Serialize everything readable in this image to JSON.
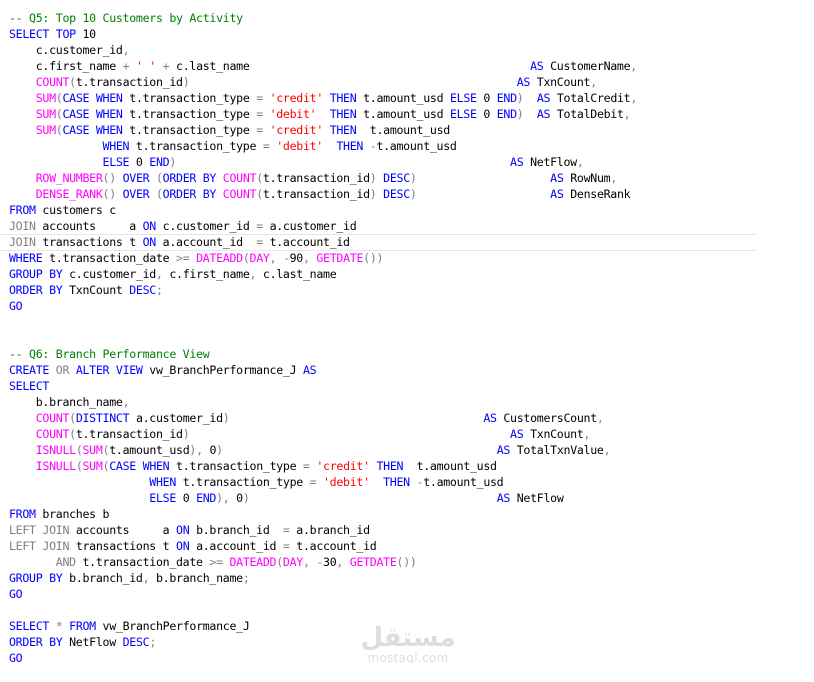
{
  "editor": {
    "lines": [
      [
        {
          "t": "-- Q5: Top 10 Customers by Activity",
          "c": "cm"
        }
      ],
      [
        {
          "t": "SELECT TOP ",
          "c": "kw"
        },
        {
          "t": "10",
          "c": "tx"
        }
      ],
      [
        {
          "t": "    c.customer_id",
          "c": "tx"
        },
        {
          "t": ",",
          "c": "gr"
        }
      ],
      [
        {
          "t": "    c.first_name ",
          "c": "tx"
        },
        {
          "t": "+ ",
          "c": "gr"
        },
        {
          "t": "' '",
          "c": "str"
        },
        {
          "t": " + ",
          "c": "gr"
        },
        {
          "t": "c.last_name                                          ",
          "c": "tx"
        },
        {
          "t": "AS ",
          "c": "kw"
        },
        {
          "t": "CustomerName",
          "c": "tx"
        },
        {
          "t": ",",
          "c": "gr"
        }
      ],
      [
        {
          "t": "    COUNT",
          "c": "fn"
        },
        {
          "t": "(",
          "c": "gr"
        },
        {
          "t": "t.transaction_id",
          "c": "tx"
        },
        {
          "t": ")                                                 ",
          "c": "gr"
        },
        {
          "t": "AS ",
          "c": "kw"
        },
        {
          "t": "TxnCount",
          "c": "tx"
        },
        {
          "t": ",",
          "c": "gr"
        }
      ],
      [
        {
          "t": "    SUM",
          "c": "fn"
        },
        {
          "t": "(",
          "c": "gr"
        },
        {
          "t": "CASE WHEN ",
          "c": "kw"
        },
        {
          "t": "t.transaction_type ",
          "c": "tx"
        },
        {
          "t": "= ",
          "c": "gr"
        },
        {
          "t": "'credit'",
          "c": "str"
        },
        {
          "t": " THEN ",
          "c": "kw"
        },
        {
          "t": "t.amount_usd ",
          "c": "tx"
        },
        {
          "t": "ELSE ",
          "c": "kw"
        },
        {
          "t": "0 ",
          "c": "tx"
        },
        {
          "t": "END",
          "c": "kw"
        },
        {
          "t": ")  ",
          "c": "gr"
        },
        {
          "t": "AS ",
          "c": "kw"
        },
        {
          "t": "TotalCredit",
          "c": "tx"
        },
        {
          "t": ",",
          "c": "gr"
        }
      ],
      [
        {
          "t": "    SUM",
          "c": "fn"
        },
        {
          "t": "(",
          "c": "gr"
        },
        {
          "t": "CASE WHEN ",
          "c": "kw"
        },
        {
          "t": "t.transaction_type ",
          "c": "tx"
        },
        {
          "t": "= ",
          "c": "gr"
        },
        {
          "t": "'debit'",
          "c": "str"
        },
        {
          "t": "  THEN ",
          "c": "kw"
        },
        {
          "t": "t.amount_usd ",
          "c": "tx"
        },
        {
          "t": "ELSE ",
          "c": "kw"
        },
        {
          "t": "0 ",
          "c": "tx"
        },
        {
          "t": "END",
          "c": "kw"
        },
        {
          "t": ")  ",
          "c": "gr"
        },
        {
          "t": "AS ",
          "c": "kw"
        },
        {
          "t": "TotalDebit",
          "c": "tx"
        },
        {
          "t": ",",
          "c": "gr"
        }
      ],
      [
        {
          "t": "    SUM",
          "c": "fn"
        },
        {
          "t": "(",
          "c": "gr"
        },
        {
          "t": "CASE WHEN ",
          "c": "kw"
        },
        {
          "t": "t.transaction_type ",
          "c": "tx"
        },
        {
          "t": "= ",
          "c": "gr"
        },
        {
          "t": "'credit'",
          "c": "str"
        },
        {
          "t": " THEN  ",
          "c": "kw"
        },
        {
          "t": "t.amount_usd",
          "c": "tx"
        }
      ],
      [
        {
          "t": "              WHEN ",
          "c": "kw"
        },
        {
          "t": "t.transaction_type ",
          "c": "tx"
        },
        {
          "t": "= ",
          "c": "gr"
        },
        {
          "t": "'debit'",
          "c": "str"
        },
        {
          "t": "  THEN ",
          "c": "kw"
        },
        {
          "t": "-",
          "c": "gr"
        },
        {
          "t": "t.amount_usd",
          "c": "tx"
        }
      ],
      [
        {
          "t": "              ELSE ",
          "c": "kw"
        },
        {
          "t": "0 ",
          "c": "tx"
        },
        {
          "t": "END",
          "c": "kw"
        },
        {
          "t": ")                                                  ",
          "c": "gr"
        },
        {
          "t": "AS ",
          "c": "kw"
        },
        {
          "t": "NetFlow",
          "c": "tx"
        },
        {
          "t": ",",
          "c": "gr"
        }
      ],
      [
        {
          "t": "    ROW_NUMBER",
          "c": "fn"
        },
        {
          "t": "() ",
          "c": "gr"
        },
        {
          "t": "OVER ",
          "c": "kw"
        },
        {
          "t": "(",
          "c": "gr"
        },
        {
          "t": "ORDER BY ",
          "c": "kw"
        },
        {
          "t": "COUNT",
          "c": "fn"
        },
        {
          "t": "(",
          "c": "gr"
        },
        {
          "t": "t.transaction_id",
          "c": "tx"
        },
        {
          "t": ") ",
          "c": "gr"
        },
        {
          "t": "DESC",
          "c": "kw"
        },
        {
          "t": ")                    ",
          "c": "gr"
        },
        {
          "t": "AS ",
          "c": "kw"
        },
        {
          "t": "RowNum",
          "c": "tx"
        },
        {
          "t": ",",
          "c": "gr"
        }
      ],
      [
        {
          "t": "    DENSE_RANK",
          "c": "fn"
        },
        {
          "t": "() ",
          "c": "gr"
        },
        {
          "t": "OVER ",
          "c": "kw"
        },
        {
          "t": "(",
          "c": "gr"
        },
        {
          "t": "ORDER BY ",
          "c": "kw"
        },
        {
          "t": "COUNT",
          "c": "fn"
        },
        {
          "t": "(",
          "c": "gr"
        },
        {
          "t": "t.transaction_id",
          "c": "tx"
        },
        {
          "t": ") ",
          "c": "gr"
        },
        {
          "t": "DESC",
          "c": "kw"
        },
        {
          "t": ")                    ",
          "c": "gr"
        },
        {
          "t": "AS ",
          "c": "kw"
        },
        {
          "t": "DenseRank",
          "c": "tx"
        }
      ],
      [
        {
          "t": "FROM ",
          "c": "kw"
        },
        {
          "t": "customers c",
          "c": "tx"
        }
      ],
      [
        {
          "t": "JOIN ",
          "c": "gr"
        },
        {
          "t": "accounts     a ",
          "c": "tx"
        },
        {
          "t": "ON ",
          "c": "kw"
        },
        {
          "t": "c.customer_id ",
          "c": "tx"
        },
        {
          "t": "= ",
          "c": "gr"
        },
        {
          "t": "a.customer_id",
          "c": "tx"
        }
      ],
      [
        {
          "t": "JOIN ",
          "c": "gr"
        },
        {
          "t": "transactions t ",
          "c": "tx"
        },
        {
          "t": "ON ",
          "c": "kw"
        },
        {
          "t": "a.account_id  ",
          "c": "tx"
        },
        {
          "t": "= ",
          "c": "gr"
        },
        {
          "t": "t.account_id",
          "c": "tx"
        }
      ],
      [
        {
          "t": "WHERE ",
          "c": "kw"
        },
        {
          "t": "t.transaction_date ",
          "c": "tx"
        },
        {
          "t": ">= ",
          "c": "gr"
        },
        {
          "t": "DATEADD",
          "c": "fn"
        },
        {
          "t": "(",
          "c": "gr"
        },
        {
          "t": "DAY",
          "c": "fn"
        },
        {
          "t": ", ",
          "c": "gr"
        },
        {
          "t": "-",
          "c": "gr"
        },
        {
          "t": "90",
          "c": "tx"
        },
        {
          "t": ", ",
          "c": "gr"
        },
        {
          "t": "GETDATE",
          "c": "fn"
        },
        {
          "t": "())",
          "c": "gr"
        }
      ],
      [
        {
          "t": "GROUP BY ",
          "c": "kw"
        },
        {
          "t": "c.customer_id",
          "c": "tx"
        },
        {
          "t": ", ",
          "c": "gr"
        },
        {
          "t": "c.first_name",
          "c": "tx"
        },
        {
          "t": ", ",
          "c": "gr"
        },
        {
          "t": "c.last_name",
          "c": "tx"
        }
      ],
      [
        {
          "t": "ORDER BY ",
          "c": "kw"
        },
        {
          "t": "TxnCount ",
          "c": "tx"
        },
        {
          "t": "DESC",
          "c": "kw"
        },
        {
          "t": ";",
          "c": "gr"
        }
      ],
      [
        {
          "t": "GO",
          "c": "kw"
        }
      ],
      [],
      [],
      [
        {
          "t": "-- Q6: Branch Performance View",
          "c": "cm"
        }
      ],
      [
        {
          "t": "CREATE ",
          "c": "kw"
        },
        {
          "t": "OR ",
          "c": "gr"
        },
        {
          "t": "ALTER VIEW ",
          "c": "kw"
        },
        {
          "t": "vw_BranchPerformance_J ",
          "c": "tx"
        },
        {
          "t": "AS",
          "c": "kw"
        }
      ],
      [
        {
          "t": "SELECT",
          "c": "kw"
        }
      ],
      [
        {
          "t": "    b.branch_name",
          "c": "tx"
        },
        {
          "t": ",",
          "c": "gr"
        }
      ],
      [
        {
          "t": "    COUNT",
          "c": "fn"
        },
        {
          "t": "(",
          "c": "gr"
        },
        {
          "t": "DISTINCT ",
          "c": "kw"
        },
        {
          "t": "a.customer_id",
          "c": "tx"
        },
        {
          "t": ")                                      ",
          "c": "gr"
        },
        {
          "t": "AS ",
          "c": "kw"
        },
        {
          "t": "CustomersCount",
          "c": "tx"
        },
        {
          "t": ",",
          "c": "gr"
        }
      ],
      [
        {
          "t": "    COUNT",
          "c": "fn"
        },
        {
          "t": "(",
          "c": "gr"
        },
        {
          "t": "t.transaction_id",
          "c": "tx"
        },
        {
          "t": ")                                                ",
          "c": "gr"
        },
        {
          "t": "AS ",
          "c": "kw"
        },
        {
          "t": "TxnCount",
          "c": "tx"
        },
        {
          "t": ",",
          "c": "gr"
        }
      ],
      [
        {
          "t": "    ISNULL",
          "c": "fn"
        },
        {
          "t": "(",
          "c": "gr"
        },
        {
          "t": "SUM",
          "c": "fn"
        },
        {
          "t": "(",
          "c": "gr"
        },
        {
          "t": "t.amount_usd",
          "c": "tx"
        },
        {
          "t": "), ",
          "c": "gr"
        },
        {
          "t": "0",
          "c": "tx"
        },
        {
          "t": ")                                         ",
          "c": "gr"
        },
        {
          "t": "AS ",
          "c": "kw"
        },
        {
          "t": "TotalTxnValue",
          "c": "tx"
        },
        {
          "t": ",",
          "c": "gr"
        }
      ],
      [
        {
          "t": "    ISNULL",
          "c": "fn"
        },
        {
          "t": "(",
          "c": "gr"
        },
        {
          "t": "SUM",
          "c": "fn"
        },
        {
          "t": "(",
          "c": "gr"
        },
        {
          "t": "CASE WHEN ",
          "c": "kw"
        },
        {
          "t": "t.transaction_type ",
          "c": "tx"
        },
        {
          "t": "= ",
          "c": "gr"
        },
        {
          "t": "'credit'",
          "c": "str"
        },
        {
          "t": " THEN  ",
          "c": "kw"
        },
        {
          "t": "t.amount_usd",
          "c": "tx"
        }
      ],
      [
        {
          "t": "                     WHEN ",
          "c": "kw"
        },
        {
          "t": "t.transaction_type ",
          "c": "tx"
        },
        {
          "t": "= ",
          "c": "gr"
        },
        {
          "t": "'debit'",
          "c": "str"
        },
        {
          "t": "  THEN ",
          "c": "kw"
        },
        {
          "t": "-",
          "c": "gr"
        },
        {
          "t": "t.amount_usd",
          "c": "tx"
        }
      ],
      [
        {
          "t": "                     ELSE ",
          "c": "kw"
        },
        {
          "t": "0 ",
          "c": "tx"
        },
        {
          "t": "END",
          "c": "kw"
        },
        {
          "t": "), ",
          "c": "gr"
        },
        {
          "t": "0",
          "c": "tx"
        },
        {
          "t": ")                                     ",
          "c": "gr"
        },
        {
          "t": "AS ",
          "c": "kw"
        },
        {
          "t": "NetFlow",
          "c": "tx"
        }
      ],
      [
        {
          "t": "FROM ",
          "c": "kw"
        },
        {
          "t": "branches b",
          "c": "tx"
        }
      ],
      [
        {
          "t": "LEFT JOIN ",
          "c": "gr"
        },
        {
          "t": "accounts     a ",
          "c": "tx"
        },
        {
          "t": "ON ",
          "c": "kw"
        },
        {
          "t": "b.branch_id  ",
          "c": "tx"
        },
        {
          "t": "= ",
          "c": "gr"
        },
        {
          "t": "a.branch_id",
          "c": "tx"
        }
      ],
      [
        {
          "t": "LEFT JOIN ",
          "c": "gr"
        },
        {
          "t": "transactions t ",
          "c": "tx"
        },
        {
          "t": "ON ",
          "c": "kw"
        },
        {
          "t": "a.account_id ",
          "c": "tx"
        },
        {
          "t": "= ",
          "c": "gr"
        },
        {
          "t": "t.account_id",
          "c": "tx"
        }
      ],
      [
        {
          "t": "       AND ",
          "c": "gr"
        },
        {
          "t": "t.transaction_date ",
          "c": "tx"
        },
        {
          "t": ">= ",
          "c": "gr"
        },
        {
          "t": "DATEADD",
          "c": "fn"
        },
        {
          "t": "(",
          "c": "gr"
        },
        {
          "t": "DAY",
          "c": "fn"
        },
        {
          "t": ", ",
          "c": "gr"
        },
        {
          "t": "-",
          "c": "gr"
        },
        {
          "t": "30",
          "c": "tx"
        },
        {
          "t": ", ",
          "c": "gr"
        },
        {
          "t": "GETDATE",
          "c": "fn"
        },
        {
          "t": "())",
          "c": "gr"
        }
      ],
      [
        {
          "t": "GROUP BY ",
          "c": "kw"
        },
        {
          "t": "b.branch_id",
          "c": "tx"
        },
        {
          "t": ", ",
          "c": "gr"
        },
        {
          "t": "b.branch_name",
          "c": "tx"
        },
        {
          "t": ";",
          "c": "gr"
        }
      ],
      [
        {
          "t": "GO",
          "c": "kw"
        }
      ],
      [],
      [
        {
          "t": "SELECT ",
          "c": "kw"
        },
        {
          "t": "* ",
          "c": "gr"
        },
        {
          "t": "FROM ",
          "c": "kw"
        },
        {
          "t": "vw_BranchPerformance_J",
          "c": "tx"
        }
      ],
      [
        {
          "t": "ORDER BY ",
          "c": "kw"
        },
        {
          "t": "NetFlow ",
          "c": "tx"
        },
        {
          "t": "DESC",
          "c": "kw"
        },
        {
          "t": ";",
          "c": "gr"
        }
      ],
      [
        {
          "t": "GO",
          "c": "kw"
        }
      ]
    ],
    "current_line": 14
  },
  "watermark": {
    "arabic": "مستقل",
    "latin": "mostaql.com"
  },
  "colors": {
    "keyword": "#0000ff",
    "function": "#ff00ff",
    "string": "#ff0000",
    "comment": "#008000",
    "operator": "#808080",
    "text": "#000000",
    "background": "#ffffff"
  }
}
